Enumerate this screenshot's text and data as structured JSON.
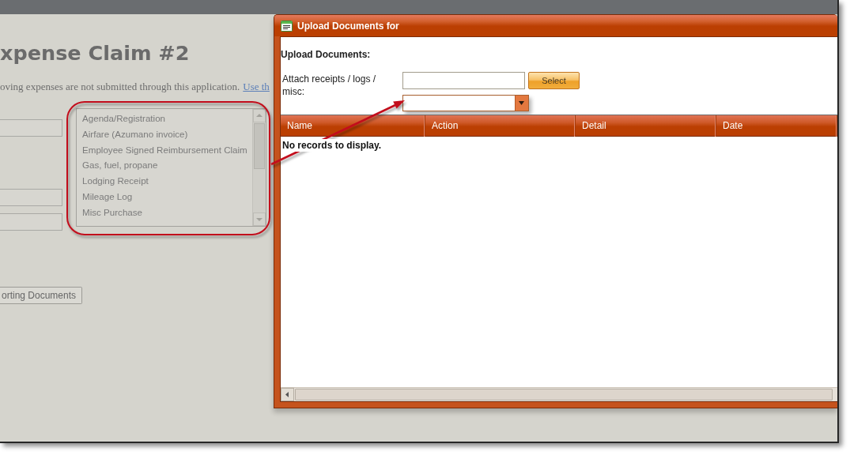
{
  "page": {
    "heading": "xpense Claim #2",
    "notice": {
      "text": "oving expenses are not submitted through this application.",
      "link": "Use th"
    },
    "document_types": [
      {
        "label": "Agenda/Registration",
        "selected": false
      },
      {
        "label": "Airfare (Azumano invoice)",
        "selected": false
      },
      {
        "label": "Employee Signed Reimbursement Claim",
        "selected": false
      },
      {
        "label": "Gas, fuel, propane",
        "selected": false
      },
      {
        "label": "Lodging Receipt",
        "selected": false
      },
      {
        "label": "Mileage Log",
        "selected": false
      },
      {
        "label": "Misc Purchase",
        "selected": false
      }
    ],
    "documents_button": "orting Documents"
  },
  "dialog": {
    "title": "Upload Documents for",
    "section_title": "Upload Documents:",
    "attach_label": "Attach receipts / logs / misc:",
    "select_button": "Select",
    "grid": {
      "columns": [
        "Name",
        "Action",
        "Detail",
        "Date"
      ],
      "empty_message": "No records to display."
    }
  }
}
